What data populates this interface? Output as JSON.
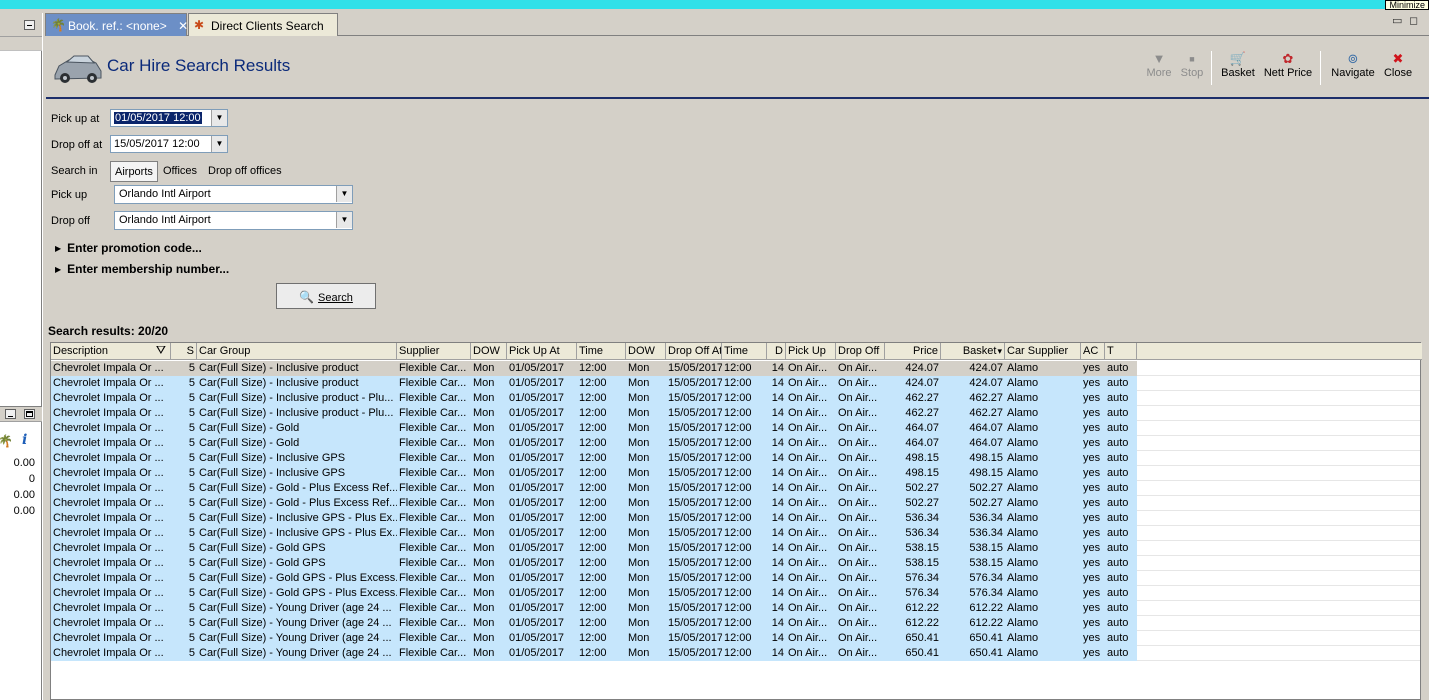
{
  "minimize_tip": "Minimize",
  "tabs": [
    {
      "label": "Book. ref.: <none>",
      "active": true
    },
    {
      "label": "Direct Clients Search",
      "active": false
    }
  ],
  "header": {
    "title": "Car Hire Search Results"
  },
  "toolbar": {
    "more": "More",
    "stop": "Stop",
    "basket": "Basket",
    "nett_price": "Nett Price",
    "navigate": "Navigate",
    "close": "Close"
  },
  "form": {
    "pickup_at_label": "Pick up at",
    "pickup_at_value": "01/05/2017 12:00",
    "dropoff_at_label": "Drop off at",
    "dropoff_at_value": "15/05/2017 12:00",
    "search_in_label": "Search in",
    "search_in_options": [
      "Airports",
      "Offices",
      "Drop off offices"
    ],
    "search_in_selected": "Airports",
    "pickup_label": "Pick up",
    "pickup_value": "Orlando Intl Airport",
    "dropoff_label": "Drop off",
    "dropoff_value": "Orlando Intl Airport",
    "promo": "Enter promotion code...",
    "membership": "Enter membership number...",
    "search_button": "Search"
  },
  "results": {
    "label": "Search results: 20/20",
    "columns": [
      "Description",
      "S",
      "Car Group",
      "Supplier",
      "DOW",
      "Pick Up At",
      "Time",
      "DOW",
      "Drop Off At",
      "Time",
      "D",
      "Pick Up",
      "Drop Off",
      "Price",
      "Basket",
      "Car Supplier",
      "AC",
      "T"
    ],
    "rows": [
      [
        "Chevrolet Impala Or ...",
        "5",
        "Car(Full Size) - Inclusive product",
        "Flexible Car...",
        "Mon",
        "01/05/2017",
        "12:00",
        "Mon",
        "15/05/2017",
        "12:00",
        "14",
        "On Air...",
        "On Air...",
        "424.07",
        "424.07",
        "Alamo",
        "yes",
        "auto"
      ],
      [
        "Chevrolet Impala Or ...",
        "5",
        "Car(Full Size) - Inclusive product",
        "Flexible Car...",
        "Mon",
        "01/05/2017",
        "12:00",
        "Mon",
        "15/05/2017",
        "12:00",
        "14",
        "On Air...",
        "On Air...",
        "424.07",
        "424.07",
        "Alamo",
        "yes",
        "auto"
      ],
      [
        "Chevrolet Impala Or ...",
        "5",
        "Car(Full Size) - Inclusive product - Plu...",
        "Flexible Car...",
        "Mon",
        "01/05/2017",
        "12:00",
        "Mon",
        "15/05/2017",
        "12:00",
        "14",
        "On Air...",
        "On Air...",
        "462.27",
        "462.27",
        "Alamo",
        "yes",
        "auto"
      ],
      [
        "Chevrolet Impala Or ...",
        "5",
        "Car(Full Size) - Inclusive product - Plu...",
        "Flexible Car...",
        "Mon",
        "01/05/2017",
        "12:00",
        "Mon",
        "15/05/2017",
        "12:00",
        "14",
        "On Air...",
        "On Air...",
        "462.27",
        "462.27",
        "Alamo",
        "yes",
        "auto"
      ],
      [
        "Chevrolet Impala Or ...",
        "5",
        "Car(Full Size) - Gold",
        "Flexible Car...",
        "Mon",
        "01/05/2017",
        "12:00",
        "Mon",
        "15/05/2017",
        "12:00",
        "14",
        "On Air...",
        "On Air...",
        "464.07",
        "464.07",
        "Alamo",
        "yes",
        "auto"
      ],
      [
        "Chevrolet Impala Or ...",
        "5",
        "Car(Full Size) - Gold",
        "Flexible Car...",
        "Mon",
        "01/05/2017",
        "12:00",
        "Mon",
        "15/05/2017",
        "12:00",
        "14",
        "On Air...",
        "On Air...",
        "464.07",
        "464.07",
        "Alamo",
        "yes",
        "auto"
      ],
      [
        "Chevrolet Impala Or ...",
        "5",
        "Car(Full Size) - Inclusive GPS",
        "Flexible Car...",
        "Mon",
        "01/05/2017",
        "12:00",
        "Mon",
        "15/05/2017",
        "12:00",
        "14",
        "On Air...",
        "On Air...",
        "498.15",
        "498.15",
        "Alamo",
        "yes",
        "auto"
      ],
      [
        "Chevrolet Impala Or ...",
        "5",
        "Car(Full Size) - Inclusive GPS",
        "Flexible Car...",
        "Mon",
        "01/05/2017",
        "12:00",
        "Mon",
        "15/05/2017",
        "12:00",
        "14",
        "On Air...",
        "On Air...",
        "498.15",
        "498.15",
        "Alamo",
        "yes",
        "auto"
      ],
      [
        "Chevrolet Impala Or ...",
        "5",
        "Car(Full Size) - Gold - Plus Excess Ref...",
        "Flexible Car...",
        "Mon",
        "01/05/2017",
        "12:00",
        "Mon",
        "15/05/2017",
        "12:00",
        "14",
        "On Air...",
        "On Air...",
        "502.27",
        "502.27",
        "Alamo",
        "yes",
        "auto"
      ],
      [
        "Chevrolet Impala Or ...",
        "5",
        "Car(Full Size) - Gold - Plus Excess Ref...",
        "Flexible Car...",
        "Mon",
        "01/05/2017",
        "12:00",
        "Mon",
        "15/05/2017",
        "12:00",
        "14",
        "On Air...",
        "On Air...",
        "502.27",
        "502.27",
        "Alamo",
        "yes",
        "auto"
      ],
      [
        "Chevrolet Impala Or ...",
        "5",
        "Car(Full Size) - Inclusive GPS - Plus Ex...",
        "Flexible Car...",
        "Mon",
        "01/05/2017",
        "12:00",
        "Mon",
        "15/05/2017",
        "12:00",
        "14",
        "On Air...",
        "On Air...",
        "536.34",
        "536.34",
        "Alamo",
        "yes",
        "auto"
      ],
      [
        "Chevrolet Impala Or ...",
        "5",
        "Car(Full Size) - Inclusive GPS - Plus Ex...",
        "Flexible Car...",
        "Mon",
        "01/05/2017",
        "12:00",
        "Mon",
        "15/05/2017",
        "12:00",
        "14",
        "On Air...",
        "On Air...",
        "536.34",
        "536.34",
        "Alamo",
        "yes",
        "auto"
      ],
      [
        "Chevrolet Impala Or ...",
        "5",
        "Car(Full Size) - Gold GPS",
        "Flexible Car...",
        "Mon",
        "01/05/2017",
        "12:00",
        "Mon",
        "15/05/2017",
        "12:00",
        "14",
        "On Air...",
        "On Air...",
        "538.15",
        "538.15",
        "Alamo",
        "yes",
        "auto"
      ],
      [
        "Chevrolet Impala Or ...",
        "5",
        "Car(Full Size) - Gold GPS",
        "Flexible Car...",
        "Mon",
        "01/05/2017",
        "12:00",
        "Mon",
        "15/05/2017",
        "12:00",
        "14",
        "On Air...",
        "On Air...",
        "538.15",
        "538.15",
        "Alamo",
        "yes",
        "auto"
      ],
      [
        "Chevrolet Impala Or ...",
        "5",
        "Car(Full Size) - Gold GPS - Plus Excess...",
        "Flexible Car...",
        "Mon",
        "01/05/2017",
        "12:00",
        "Mon",
        "15/05/2017",
        "12:00",
        "14",
        "On Air...",
        "On Air...",
        "576.34",
        "576.34",
        "Alamo",
        "yes",
        "auto"
      ],
      [
        "Chevrolet Impala Or ...",
        "5",
        "Car(Full Size) - Gold GPS - Plus Excess...",
        "Flexible Car...",
        "Mon",
        "01/05/2017",
        "12:00",
        "Mon",
        "15/05/2017",
        "12:00",
        "14",
        "On Air...",
        "On Air...",
        "576.34",
        "576.34",
        "Alamo",
        "yes",
        "auto"
      ],
      [
        "Chevrolet Impala Or ...",
        "5",
        "Car(Full Size) - Young Driver (age 24 ...",
        "Flexible Car...",
        "Mon",
        "01/05/2017",
        "12:00",
        "Mon",
        "15/05/2017",
        "12:00",
        "14",
        "On Air...",
        "On Air...",
        "612.22",
        "612.22",
        "Alamo",
        "yes",
        "auto"
      ],
      [
        "Chevrolet Impala Or ...",
        "5",
        "Car(Full Size) - Young Driver (age 24 ...",
        "Flexible Car...",
        "Mon",
        "01/05/2017",
        "12:00",
        "Mon",
        "15/05/2017",
        "12:00",
        "14",
        "On Air...",
        "On Air...",
        "612.22",
        "612.22",
        "Alamo",
        "yes",
        "auto"
      ],
      [
        "Chevrolet Impala Or ...",
        "5",
        "Car(Full Size) - Young Driver (age 24 ...",
        "Flexible Car...",
        "Mon",
        "01/05/2017",
        "12:00",
        "Mon",
        "15/05/2017",
        "12:00",
        "14",
        "On Air...",
        "On Air...",
        "650.41",
        "650.41",
        "Alamo",
        "yes",
        "auto"
      ],
      [
        "Chevrolet Impala Or ...",
        "5",
        "Car(Full Size) - Young Driver (age 24 ...",
        "Flexible Car...",
        "Mon",
        "01/05/2017",
        "12:00",
        "Mon",
        "15/05/2017",
        "12:00",
        "14",
        "On Air...",
        "On Air...",
        "650.41",
        "650.41",
        "Alamo",
        "yes",
        "auto"
      ]
    ]
  },
  "left_panel": {
    "values": [
      "0.00",
      "0",
      "0.00",
      "0.00"
    ]
  },
  "icons": {
    "tab_active": "palm-tree-icon",
    "tab_inactive": "clients-icon",
    "header": "car-icon",
    "more": "down-arrow-icon",
    "stop": "stop-icon",
    "basket": "basket-icon",
    "nett_price": "money-icon",
    "navigate": "compass-icon",
    "close": "close-icon",
    "search": "magnifier-icon",
    "filter": "filter-icon",
    "sort": "sort-desc-icon",
    "info": "info-icon"
  },
  "colors": {
    "active_tab": "#6c8fc6",
    "title": "#0b2a7a",
    "header_rule": "#1c2e6a",
    "row_highlight": "#c6e6fc",
    "close_red": "#d0141c",
    "topstrip": "#31e0e8"
  }
}
